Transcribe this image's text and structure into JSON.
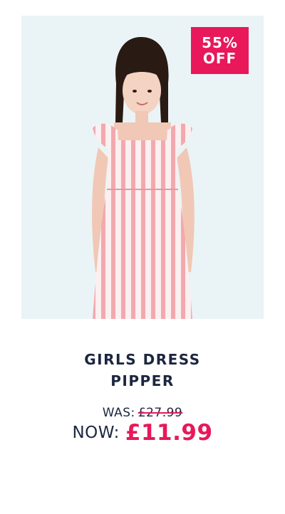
{
  "product": {
    "badge_line1": "55%",
    "badge_line2": "OFF",
    "title_line1": "GIRLS DRESS",
    "title_line2": "PIPPER",
    "was_label": "WAS:",
    "was_price": "£27.99",
    "now_label": "NOW:",
    "now_price": "£11.99",
    "image_icon": "product-photo-girl-in-striped-dress"
  },
  "colors": {
    "accent": "#e8185a",
    "text": "#1c2640",
    "image_background": "#eaf4f6"
  }
}
